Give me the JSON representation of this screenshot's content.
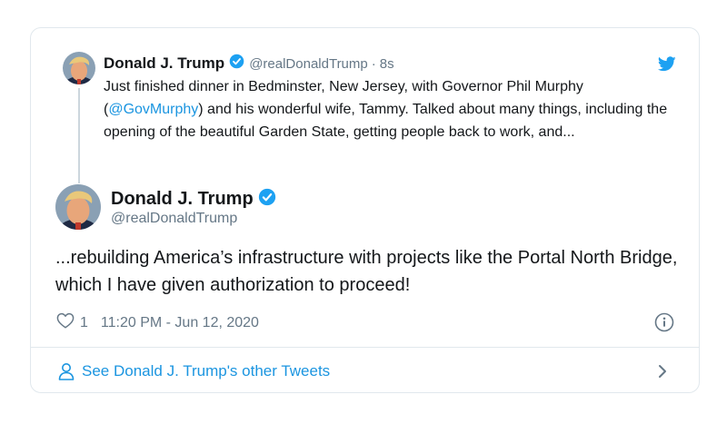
{
  "parent_tweet": {
    "name": "Donald J. Trump",
    "handle": "@realDonaldTrump",
    "separator": "·",
    "time": "8s",
    "text_before": "Just finished dinner in Bedminster, New Jersey, with Governor Phil Murphy (",
    "mention": "@GovMurphy",
    "text_after": ") and his wonderful wife, Tammy. Talked about many things, including the opening of the beautiful Garden State, getting people back to work, and..."
  },
  "main_tweet": {
    "name": "Donald J. Trump",
    "handle": "@realDonaldTrump",
    "text": "...rebuilding America’s infrastructure with projects like the Portal North Bridge, which I have given authorization to proceed!",
    "like_count": "1",
    "timestamp": "11:20 PM - Jun 12, 2020"
  },
  "footer": {
    "other_tweets_label": "See Donald J. Trump's other Tweets"
  },
  "colors": {
    "link_blue": "#1b95e0",
    "verified_blue": "#1da1f2",
    "secondary_text": "#657786",
    "border": "#e1e8ed"
  },
  "icons": [
    "verified-badge-icon",
    "twitter-bird-icon",
    "heart-icon",
    "info-icon",
    "person-icon",
    "chevron-right-icon"
  ]
}
